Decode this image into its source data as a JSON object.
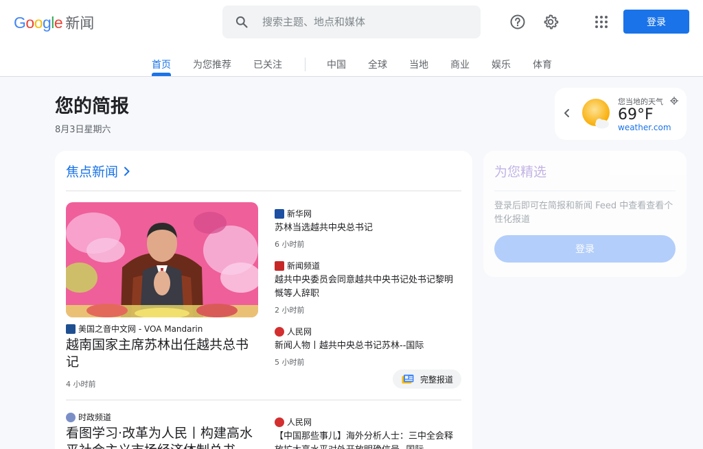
{
  "header": {
    "logo_google_letters": [
      "G",
      "o",
      "o",
      "g",
      "l",
      "e"
    ],
    "logo_news": "新闻",
    "search_placeholder": "搜索主题、地点和媒体",
    "login_label": "登录"
  },
  "nav": {
    "tabs": [
      {
        "label": "首页",
        "active": true
      },
      {
        "label": "为您推荐"
      },
      {
        "label": "已关注"
      },
      {
        "label": "中国"
      },
      {
        "label": "全球"
      },
      {
        "label": "当地"
      },
      {
        "label": "商业"
      },
      {
        "label": "娱乐"
      },
      {
        "label": "体育"
      }
    ]
  },
  "briefing": {
    "title": "您的简报",
    "date": "8月3日星期六"
  },
  "weather": {
    "label": "您当地的天气",
    "temperature": "69°F",
    "source": "weather.com"
  },
  "headlines": {
    "title": "焦点新闻",
    "main_story": {
      "source": "美国之音中文网 - VOA Mandarin",
      "title": "越南国家主席苏林出任越共总书记",
      "time": "4 小时前"
    },
    "related": [
      {
        "source": "新华网",
        "title": "苏林当选越共中央总书记",
        "time": "6 小时前"
      },
      {
        "source": "新闻频道",
        "title": "越共中央委员会同意越共中央书记处书记黎明慨等人辞职",
        "time": "2 小时前"
      },
      {
        "source": "人民网",
        "title": "新闻人物丨越共中央总书记苏林--国际",
        "time": "5 小时前"
      }
    ],
    "full_coverage_label": "完整报道",
    "second_story": {
      "source": "时政频道",
      "title": "看图学习·改革为人民丨构建高水平社会主义市场经济体制总书",
      "related_source": "人民网",
      "related_title": "【中国那些事儿】海外分析人士：三中全会释放扩大高水平对外开放明确信号--国际"
    }
  },
  "picks": {
    "title": "为您精选",
    "text": "登录后即可在简报和新闻 Feed 中查看查看个性化报道",
    "login_label": "登录"
  },
  "colors": {
    "accent": "#1a73e8",
    "background": "#f6f8fc"
  }
}
